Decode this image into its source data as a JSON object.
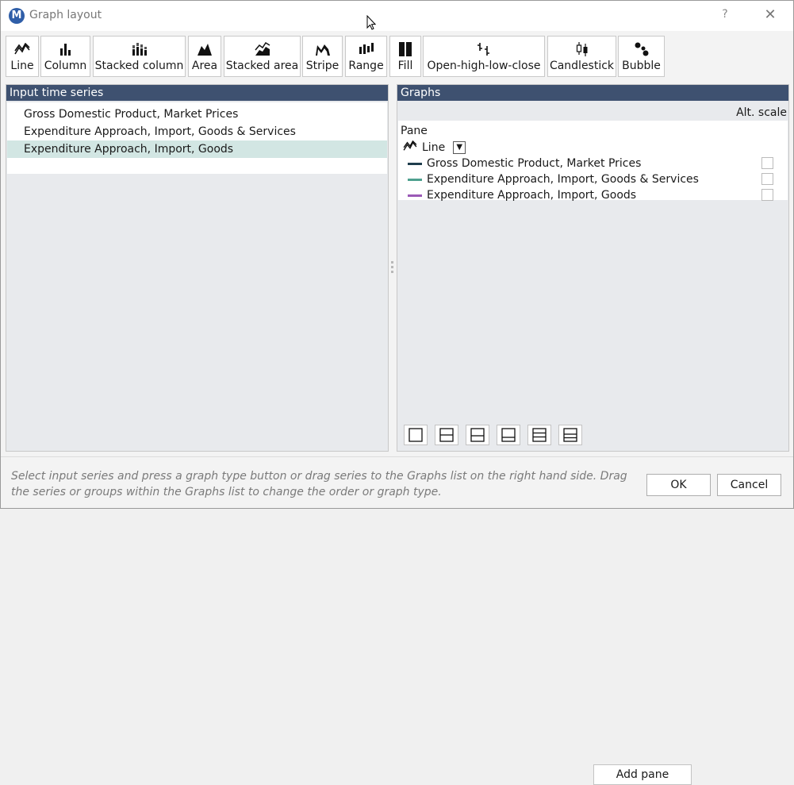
{
  "window": {
    "title": "Graph layout",
    "help": "?",
    "close": "✕",
    "app_icon_letter": "M"
  },
  "toolbar": [
    {
      "label": "Line",
      "icon": "line-chart-icon"
    },
    {
      "label": "Column",
      "icon": "column-chart-icon"
    },
    {
      "label": "Stacked column",
      "icon": "stacked-column-icon"
    },
    {
      "label": "Area",
      "icon": "area-chart-icon"
    },
    {
      "label": "Stacked area",
      "icon": "stacked-area-icon"
    },
    {
      "label": "Stripe",
      "icon": "stripe-chart-icon"
    },
    {
      "label": "Range",
      "icon": "range-chart-icon"
    },
    {
      "label": "Fill",
      "icon": "fill-chart-icon"
    },
    {
      "label": "Open-high-low-close",
      "icon": "ohlc-icon"
    },
    {
      "label": "Candlestick",
      "icon": "candlestick-icon"
    },
    {
      "label": "Bubble",
      "icon": "bubble-chart-icon"
    }
  ],
  "input_panel": {
    "title": "Input time series",
    "items": [
      "Gross Domestic Product, Market Prices",
      "Expenditure Approach, Import, Goods & Services",
      "Expenditure Approach, Import, Goods"
    ],
    "selected_index": 2
  },
  "graphs_panel": {
    "title": "Graphs",
    "alt_scale": "Alt. scale",
    "pane_label": "Pane",
    "group_label": "Line",
    "dropdown": "▼",
    "series": [
      {
        "name": "Gross Domestic Product, Market Prices",
        "color": "#1f3d4d"
      },
      {
        "name": "Expenditure Approach, Import, Goods & Services",
        "color": "#4ea08f"
      },
      {
        "name": "Expenditure Approach, Import, Goods",
        "color": "#9b59b6"
      }
    ],
    "add_pane": "Add pane"
  },
  "footer": {
    "hint": "Select input series and press a graph type button or drag series to the Graphs list on the right hand side. Drag the series or groups within the Graphs list to change the order or graph type.",
    "ok": "OK",
    "cancel": "Cancel"
  }
}
